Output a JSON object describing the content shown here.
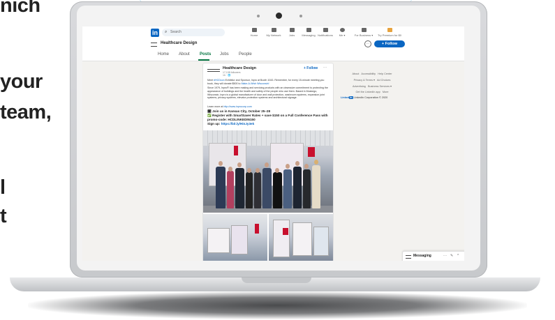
{
  "side_text": [
    "nich",
    "your",
    "team,",
    "l",
    "t"
  ],
  "nav": {
    "search_placeholder": "Search",
    "items": [
      {
        "label": "Home",
        "icon": "home-icon"
      },
      {
        "label": "My Network",
        "icon": "network-icon"
      },
      {
        "label": "Jobs",
        "icon": "jobs-icon"
      },
      {
        "label": "Messaging",
        "icon": "messaging-icon"
      },
      {
        "label": "Notifications",
        "icon": "bell-icon"
      },
      {
        "label": "Me ▾",
        "icon": "avatar-icon"
      },
      {
        "label": "For Business ▾",
        "icon": "grid-icon"
      },
      {
        "label": "Try Premium for $0",
        "icon": "premium-icon"
      }
    ]
  },
  "company": {
    "name": "Healthcare Design",
    "more_label": "···",
    "follow_label": "+ Follow"
  },
  "tabs": [
    "Home",
    "About",
    "Posts",
    "Jobs",
    "People"
  ],
  "active_tab": "Posts",
  "post": {
    "author": "Healthcare Design",
    "followers": "17,138 followers",
    "time": "1h · 🌐",
    "follow_label": "+ Follow",
    "more_label": "···",
    "para1_pre": "Meet ",
    "para1_tag": "#HCDcon",
    "para1_mid": " Exhibitor and Sponsor, Inpro at Booth 1043. Remember, for every 15-minute meeting you book, they will donate $500 to ",
    "para1_link": "Make-A-Wish Wisconsin!",
    "para2": "Since 1979, Inpro® has been making and servicing products with an obsessive commitment to protecting the appearance of buildings and the health and safety of the people who use them. Based in Muskego, Wisconsin, Inpro is a global manufacturer of door and wall protection, washroom systems, expansion joint systems, privacy systems, elevator protection systems and architectural signage.",
    "learn_pre": "Learn more at ",
    "learn_link": "http://www.inprocorp.com",
    "line1": "🗓 Join us in Kansas City, October 25–28",
    "line2": "✅ Register with SmartSaver Rates + save $150 on a Full Conference Pass with promo-code: HCDLINKEDIN150",
    "signup_pre": "Sign up: ",
    "signup_link": "https://bit.ly/HinJy3ek"
  },
  "rail": {
    "rows": [
      [
        "About",
        "Accessibility",
        "Help Center"
      ],
      [
        "Privacy & Terms ▾",
        "Ad Choices"
      ],
      [
        "Advertising",
        "Business Services ▾"
      ],
      [
        "Get the LinkedIn app",
        "More"
      ]
    ],
    "copyright_brand": "Linked",
    "copyright_in": "in",
    "copyright_text": " LinkedIn Corporation © 2020"
  },
  "messaging": {
    "label": "Messaging",
    "controls": [
      "···",
      "✎",
      "^"
    ]
  },
  "colors": {
    "linkedin_blue": "#0a66c2",
    "active_tab_green": "#057642",
    "inpro_red": "#c8102e"
  }
}
